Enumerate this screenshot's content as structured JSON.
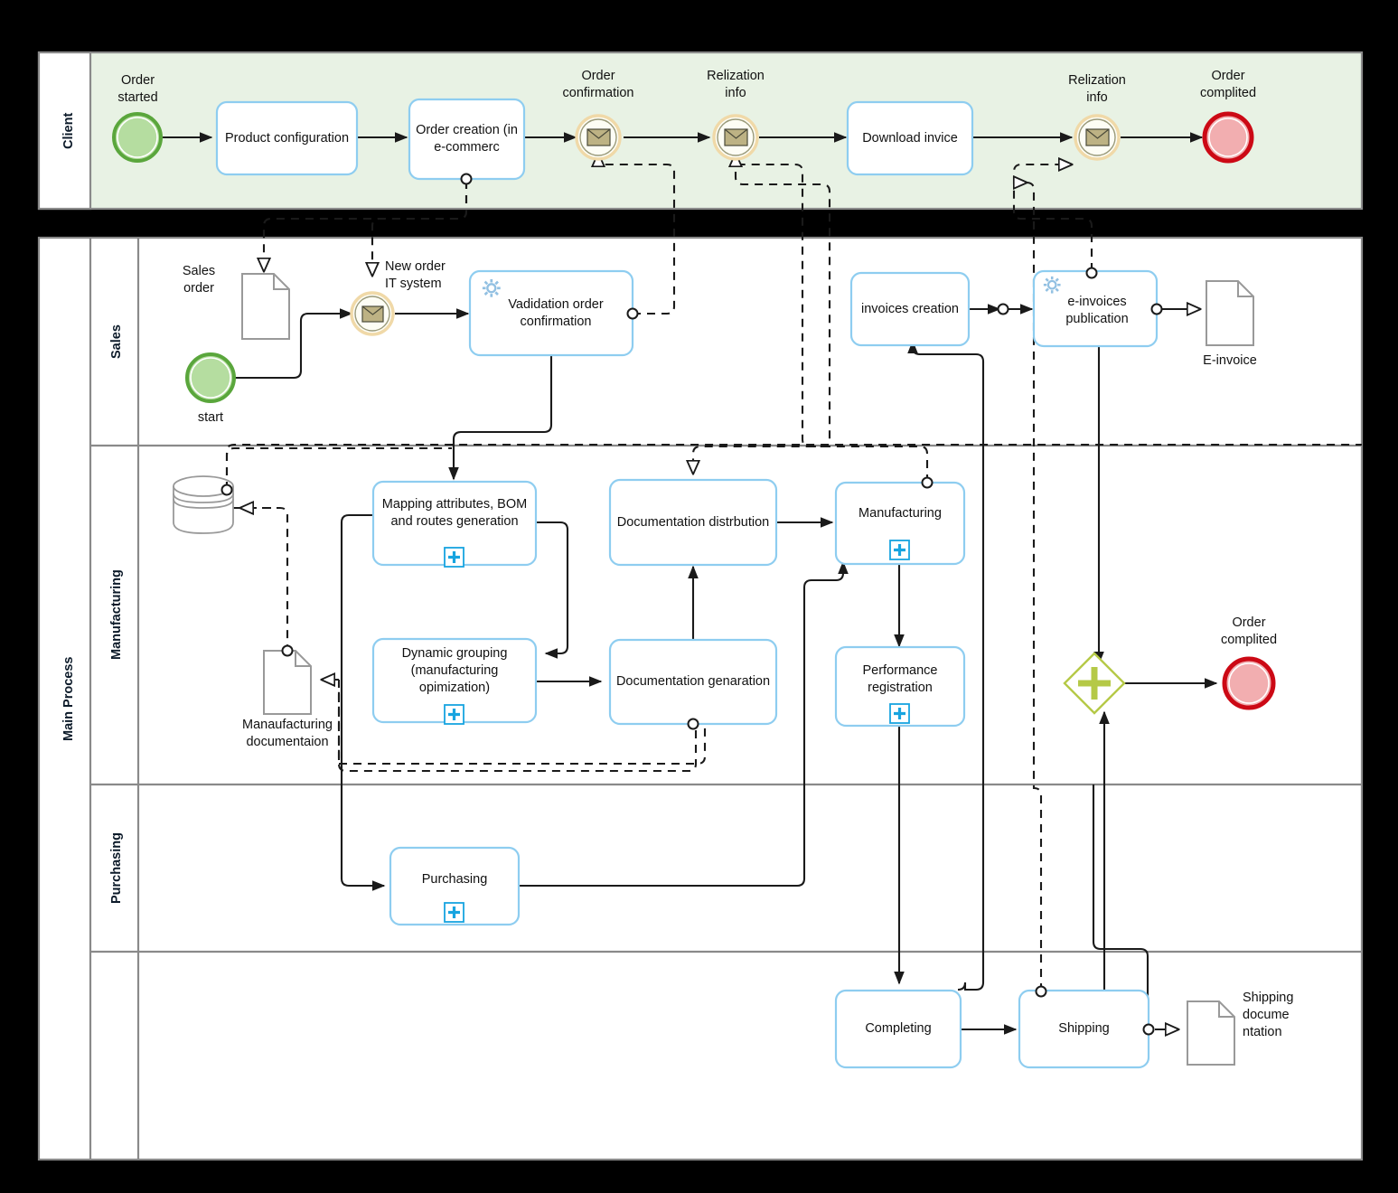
{
  "diagram": {
    "type": "bpmn-collaboration-diagram",
    "title": "Order-to-delivery BPMN process",
    "colors": {
      "client_pool_fill": "#e8f2e4",
      "task_border": "#8ecdf0",
      "task_fill": "#ffffff",
      "start_event_stroke": "#5aa63c",
      "start_event_fill": "#b5dda0",
      "end_event_stroke": "#cc0915",
      "end_event_fill": "#f2aeb0",
      "message_event_stroke": "#f0d9a8",
      "message_envelope_fill": "#bdb284",
      "gateway_stroke": "#b5c947",
      "gateway_plus": "#b5c947",
      "marker_blue": "#17a4e0",
      "artifact_stroke": "#999999",
      "lane_stroke": "#8a8a8a",
      "flow_stroke": "#1a1a1a",
      "pool_gap": "#000000"
    }
  },
  "pools": [
    {
      "name": "Client",
      "lanes": []
    },
    {
      "name": "Main Process",
      "lanes": [
        "Sales",
        "Manufacturing",
        "Purchasing",
        ""
      ]
    }
  ],
  "client_lane": {
    "label": "Client",
    "elements": [
      {
        "id": "order-started",
        "kind": "start-event",
        "label": "Order\nstarted"
      },
      {
        "id": "product-configuration",
        "kind": "task",
        "label": "Product\nconfiguration"
      },
      {
        "id": "order-creation",
        "kind": "task",
        "label": "Order\ncreation (in\ne-commerc"
      },
      {
        "id": "order-confirmation",
        "kind": "message-event",
        "label": "Order\nconfirmation"
      },
      {
        "id": "relization-info-1",
        "kind": "message-event",
        "label": "Relization\ninfo"
      },
      {
        "id": "download-invice",
        "kind": "task",
        "label": "Download\ninvice"
      },
      {
        "id": "relization-info-2",
        "kind": "message-event",
        "label": "Relization\ninfo"
      },
      {
        "id": "order-complited-client",
        "kind": "end-event",
        "label": "Order\ncomplited"
      }
    ]
  },
  "sales_lane": {
    "label": "Sales",
    "elements": [
      {
        "id": "sales-order-artifact",
        "kind": "data-object",
        "label": "Sales\norder"
      },
      {
        "id": "start",
        "kind": "start-event",
        "label": "start"
      },
      {
        "id": "new-order-it-system",
        "kind": "message-event",
        "label": "New order\nIT system"
      },
      {
        "id": "vadidation-order-confirmation",
        "kind": "service-task",
        "label": "Vadidation\norder\nconfirmation"
      },
      {
        "id": "invoices-creation",
        "kind": "task",
        "label": "invoices\ncreation"
      },
      {
        "id": "e-invoices-publication",
        "kind": "service-task",
        "label": "e-invoices\npublication"
      },
      {
        "id": "e-invoice-artifact",
        "kind": "data-object",
        "label": "E-invoice"
      }
    ]
  },
  "manufacturing_lane": {
    "label": "Manufacturing",
    "elements": [
      {
        "id": "data-store",
        "kind": "data-store",
        "label": ""
      },
      {
        "id": "manaufacturing-documentaion",
        "kind": "data-object",
        "label": "Manaufacturing\ndocumentaion"
      },
      {
        "id": "mapping-attributes",
        "kind": "subprocess",
        "label": "Mapping attributes,\nBOM and routes\ngeneration",
        "marker": "+"
      },
      {
        "id": "dynamic-grouping",
        "kind": "subprocess",
        "label": "Dynamic grouping\n(manufacturing\nopimization)",
        "marker": "+"
      },
      {
        "id": "documentation-distrbution",
        "kind": "task",
        "label": "Documentation\ndistrbution"
      },
      {
        "id": "documentation-genaration",
        "kind": "task",
        "label": "Documentation\ngenaration"
      },
      {
        "id": "manufacturing",
        "kind": "subprocess",
        "label": "Manufacturing",
        "marker": "+"
      },
      {
        "id": "performance-registration",
        "kind": "subprocess",
        "label": "Performance\nregistration",
        "marker": "+"
      },
      {
        "id": "parallel-gateway",
        "kind": "parallel-gateway",
        "label": "+"
      },
      {
        "id": "order-complited-main",
        "kind": "end-event",
        "label": "Order\ncomplited"
      }
    ]
  },
  "purchasing_lane": {
    "label": "Purchasing",
    "elements": [
      {
        "id": "purchasing",
        "kind": "subprocess",
        "label": "Purchasing",
        "marker": "+"
      }
    ]
  },
  "shipping_lane": {
    "label": "",
    "elements": [
      {
        "id": "completing",
        "kind": "task",
        "label": "Completing"
      },
      {
        "id": "shipping",
        "kind": "task",
        "label": "Shipping"
      },
      {
        "id": "shipping-documentation-artifact",
        "kind": "data-object",
        "label": "Shipping\ndocume\nntation"
      }
    ]
  }
}
